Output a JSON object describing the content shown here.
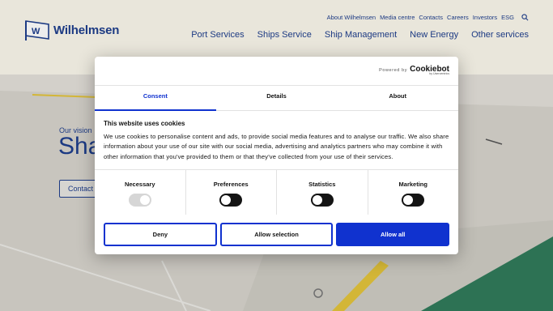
{
  "header": {
    "brand": "Wilhelmsen",
    "logo_letter": "W",
    "top_links": [
      "About Wilhelmsen",
      "Media centre",
      "Contacts",
      "Careers",
      "Investors",
      "ESG"
    ],
    "main_links": [
      "Port Services",
      "Ships Service",
      "Ship Management",
      "New Energy",
      "Other services"
    ],
    "search_icon": "search-icon"
  },
  "hero": {
    "eyebrow": "Our vision",
    "title": "Sha",
    "cta_label": "Contact"
  },
  "cookie_dialog": {
    "powered_by": "Powered by",
    "provider": "Cookiebot",
    "provider_sub": "by Usercentrics",
    "tabs": [
      "Consent",
      "Details",
      "About"
    ],
    "active_tab": "Consent",
    "heading": "This website uses cookies",
    "body": "We use cookies to personalise content and ads, to provide social media features and to analyse our traffic. We also share information about your use of our site with our social media, advertising and analytics partners who may combine it with other information that you've provided to them or that they've collected from your use of their services.",
    "categories": [
      {
        "label": "Necessary",
        "enabled": true,
        "locked": true
      },
      {
        "label": "Preferences",
        "enabled": false,
        "locked": false
      },
      {
        "label": "Statistics",
        "enabled": false,
        "locked": false
      },
      {
        "label": "Marketing",
        "enabled": false,
        "locked": false
      }
    ],
    "buttons": {
      "deny": "Deny",
      "allow_selection": "Allow selection",
      "allow_all": "Allow all"
    },
    "accent_color": "#1032cf"
  }
}
